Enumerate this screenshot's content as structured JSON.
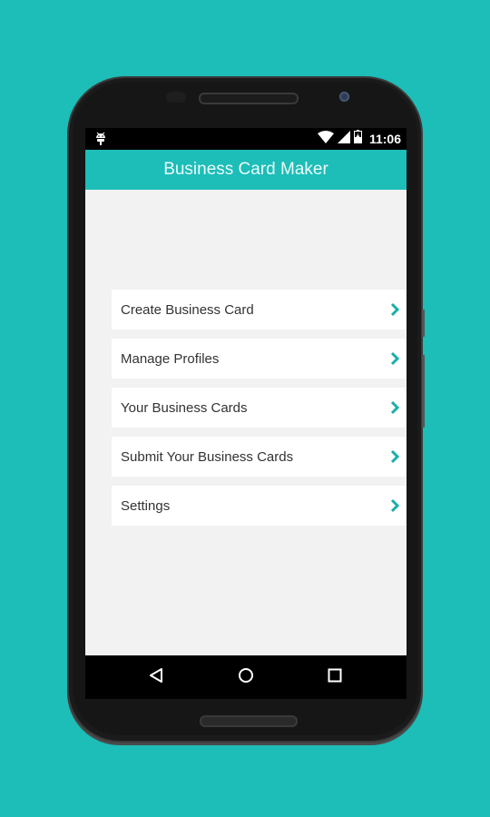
{
  "status_bar": {
    "time": "11:06",
    "icons": [
      "android-debug-icon",
      "wifi-icon",
      "cell-signal-icon",
      "battery-charging-icon"
    ]
  },
  "app_bar": {
    "title": "Business Card Maker"
  },
  "menu": {
    "items": [
      {
        "label": "Create Business Card",
        "icon": "chevron-right-icon"
      },
      {
        "label": "Manage Profiles",
        "icon": "chevron-right-icon"
      },
      {
        "label": "Your Business Cards",
        "icon": "chevron-right-icon"
      },
      {
        "label": "Submit Your Business Cards",
        "icon": "chevron-right-icon"
      },
      {
        "label": "Settings",
        "icon": "chevron-right-icon"
      }
    ]
  },
  "nav_bar": {
    "buttons": [
      "back-icon",
      "home-icon",
      "recents-icon"
    ]
  },
  "colors": {
    "background": "#1dbdb8",
    "accent": "#1dbdb8",
    "chevron": "#1aaeaa",
    "content_bg": "#f2f2f2"
  }
}
